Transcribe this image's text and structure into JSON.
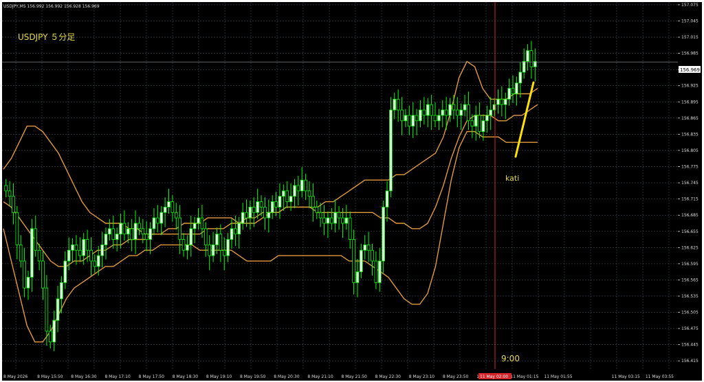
{
  "window": {
    "symbol_info": "USDJPY,M5  156.992 156.992 156.928 156.969",
    "chart_label": "USDJPY ５分足",
    "annotation_text": "kati",
    "time_marker": "9:00",
    "current_price_label": "156.969",
    "highlighted_time_label": "11 May 02:00"
  },
  "colors": {
    "background": "#000000",
    "grid": "#44505a",
    "candle": "#00ff00",
    "candle_body": "#e8ffe8",
    "band": "#e39a3c",
    "arrow": "#ffe200",
    "vline": "#d4242a",
    "label_text": "#e6d84a"
  },
  "chart_data": {
    "type": "line",
    "ylim": [
      156.4,
      157.08
    ],
    "yticks": [
      "157.075",
      "157.045",
      "157.015",
      "156.985",
      "156.955",
      "156.925",
      "156.895",
      "156.865",
      "156.835",
      "156.805",
      "156.775",
      "156.745",
      "156.715",
      "156.685",
      "156.655",
      "156.625",
      "156.595",
      "156.565",
      "156.535",
      "156.505",
      "156.475",
      "156.445",
      "156.415"
    ],
    "xticks": [
      "8 May 2026",
      "8 May 15:50",
      "8 May 16:30",
      "8 May 17:10",
      "8 May 17:50",
      "8 May 18:30",
      "8 May 19:10",
      "8 May 19:50",
      "8 May 20:30",
      "8 May 21:10",
      "8 May 21:50",
      "8 May 22:30",
      "8 May 23:10",
      "8 May 23:50",
      "11 May 00:35",
      "11 May 01:15",
      "11 May 01:55",
      "11 May 02:00",
      "11 May 03:15",
      "11 May 03:55"
    ],
    "close": [
      156.73,
      156.72,
      156.69,
      156.63,
      156.6,
      156.55,
      156.57,
      156.66,
      156.62,
      156.6,
      156.55,
      156.47,
      156.45,
      156.49,
      156.53,
      156.56,
      156.6,
      156.62,
      156.63,
      156.62,
      156.61,
      156.64,
      156.62,
      156.6,
      156.59,
      156.61,
      156.63,
      156.65,
      156.66,
      156.64,
      156.65,
      156.67,
      156.65,
      156.66,
      156.64,
      156.67,
      156.66,
      156.65,
      156.64,
      156.66,
      156.68,
      156.67,
      156.69,
      156.7,
      156.71,
      156.69,
      156.68,
      156.64,
      156.62,
      156.63,
      156.66,
      156.67,
      156.68,
      156.66,
      156.63,
      156.61,
      156.63,
      156.65,
      156.62,
      156.61,
      156.64,
      156.66,
      156.65,
      156.67,
      156.69,
      156.68,
      156.7,
      156.69,
      156.71,
      156.7,
      156.68,
      156.69,
      156.71,
      156.7,
      156.72,
      156.73,
      156.71,
      156.72,
      156.74,
      156.73,
      156.75,
      156.73,
      156.72,
      156.7,
      156.69,
      156.68,
      156.67,
      156.68,
      156.67,
      156.69,
      156.68,
      156.67,
      156.68,
      156.64,
      156.56,
      156.58,
      156.62,
      156.63,
      156.62,
      156.6,
      156.56,
      156.6,
      156.7,
      156.73,
      156.88,
      156.9,
      156.88,
      156.86,
      156.87,
      156.85,
      156.87,
      156.86,
      156.88,
      156.87,
      156.89,
      156.87,
      156.86,
      156.87,
      156.88,
      156.87,
      156.89,
      156.88,
      156.87,
      156.88,
      156.89,
      156.86,
      156.85,
      156.87,
      156.84,
      156.86,
      156.87,
      156.88,
      156.89,
      156.9,
      156.89,
      156.9,
      156.92,
      156.91,
      156.93,
      156.95,
      156.97,
      156.99,
      156.96,
      156.97
    ],
    "open": [
      156.74,
      156.73,
      156.72,
      156.69,
      156.63,
      156.6,
      156.55,
      156.57,
      156.66,
      156.62,
      156.6,
      156.55,
      156.47,
      156.45,
      156.49,
      156.53,
      156.56,
      156.6,
      156.62,
      156.63,
      156.62,
      156.61,
      156.64,
      156.62,
      156.6,
      156.59,
      156.61,
      156.63,
      156.65,
      156.66,
      156.64,
      156.65,
      156.67,
      156.65,
      156.66,
      156.64,
      156.67,
      156.66,
      156.65,
      156.64,
      156.66,
      156.68,
      156.67,
      156.69,
      156.7,
      156.71,
      156.69,
      156.68,
      156.64,
      156.62,
      156.63,
      156.66,
      156.67,
      156.68,
      156.66,
      156.63,
      156.61,
      156.63,
      156.65,
      156.62,
      156.61,
      156.64,
      156.66,
      156.65,
      156.67,
      156.69,
      156.68,
      156.7,
      156.69,
      156.71,
      156.7,
      156.68,
      156.69,
      156.71,
      156.7,
      156.72,
      156.73,
      156.71,
      156.72,
      156.74,
      156.73,
      156.75,
      156.73,
      156.72,
      156.7,
      156.69,
      156.68,
      156.67,
      156.68,
      156.67,
      156.69,
      156.68,
      156.67,
      156.68,
      156.64,
      156.56,
      156.58,
      156.62,
      156.63,
      156.62,
      156.6,
      156.56,
      156.6,
      156.7,
      156.73,
      156.88,
      156.9,
      156.88,
      156.86,
      156.87,
      156.85,
      156.87,
      156.86,
      156.88,
      156.87,
      156.89,
      156.87,
      156.86,
      156.87,
      156.88,
      156.87,
      156.89,
      156.88,
      156.87,
      156.88,
      156.89,
      156.86,
      156.85,
      156.87,
      156.84,
      156.86,
      156.87,
      156.88,
      156.89,
      156.9,
      156.89,
      156.9,
      156.92,
      156.91,
      156.93,
      156.95,
      156.97,
      156.99,
      156.96
    ],
    "band_upper": [
      156.77,
      156.79,
      156.82,
      156.85,
      156.85,
      156.84,
      156.82,
      156.8,
      156.77,
      156.74,
      156.71,
      156.69,
      156.68,
      156.67,
      156.67,
      156.67,
      156.66,
      156.66,
      156.65,
      156.65,
      156.65,
      156.65,
      156.65,
      156.65,
      156.65,
      156.65,
      156.66,
      156.66,
      156.66,
      156.67,
      156.67,
      156.68,
      156.68,
      156.69,
      156.69,
      156.69,
      156.7,
      156.7,
      156.7,
      156.7,
      156.7,
      156.71,
      156.71,
      156.72,
      156.73,
      156.74,
      156.75,
      156.75,
      156.75,
      156.75,
      156.76,
      156.76,
      156.77,
      156.78,
      156.79,
      156.8,
      156.83,
      156.88,
      156.94,
      156.97,
      156.96,
      156.92,
      156.9,
      156.9,
      156.9,
      156.91,
      156.91,
      156.91,
      156.92
    ],
    "band_middle": [
      156.71,
      156.7,
      156.68,
      156.66,
      156.64,
      156.62,
      156.6,
      156.59,
      156.59,
      156.6,
      156.6,
      156.61,
      156.62,
      156.62,
      156.63,
      156.63,
      156.64,
      156.64,
      156.64,
      156.65,
      156.65,
      156.66,
      156.66,
      156.67,
      156.67,
      156.67,
      156.68,
      156.68,
      156.68,
      156.68,
      156.67,
      156.67,
      156.67,
      156.68,
      156.69,
      156.69,
      156.7,
      156.7,
      156.7,
      156.7,
      156.69,
      156.69,
      156.69,
      156.69,
      156.69,
      156.69,
      156.69,
      156.69,
      156.68,
      156.68,
      156.67,
      156.67,
      156.66,
      156.66,
      156.67,
      156.7,
      156.74,
      156.79,
      156.83,
      156.86,
      156.87,
      156.87,
      156.87,
      156.86,
      156.86,
      156.87,
      156.87,
      156.88,
      156.89
    ],
    "band_lower": [
      156.66,
      156.6,
      156.54,
      156.48,
      156.45,
      156.45,
      156.47,
      156.5,
      156.53,
      156.55,
      156.56,
      156.57,
      156.58,
      156.59,
      156.59,
      156.6,
      156.61,
      156.61,
      156.62,
      156.62,
      156.63,
      156.63,
      156.63,
      156.63,
      156.63,
      156.62,
      156.62,
      156.62,
      156.62,
      156.62,
      156.61,
      156.6,
      156.6,
      156.6,
      156.6,
      156.61,
      156.61,
      156.61,
      156.61,
      156.61,
      156.61,
      156.61,
      156.61,
      156.61,
      156.6,
      156.6,
      156.6,
      156.59,
      156.58,
      156.57,
      156.55,
      156.53,
      156.52,
      156.52,
      156.54,
      156.59,
      156.67,
      156.75,
      156.81,
      156.84,
      156.84,
      156.83,
      156.83,
      156.83,
      156.82,
      156.82,
      156.82,
      156.82,
      156.82
    ]
  }
}
